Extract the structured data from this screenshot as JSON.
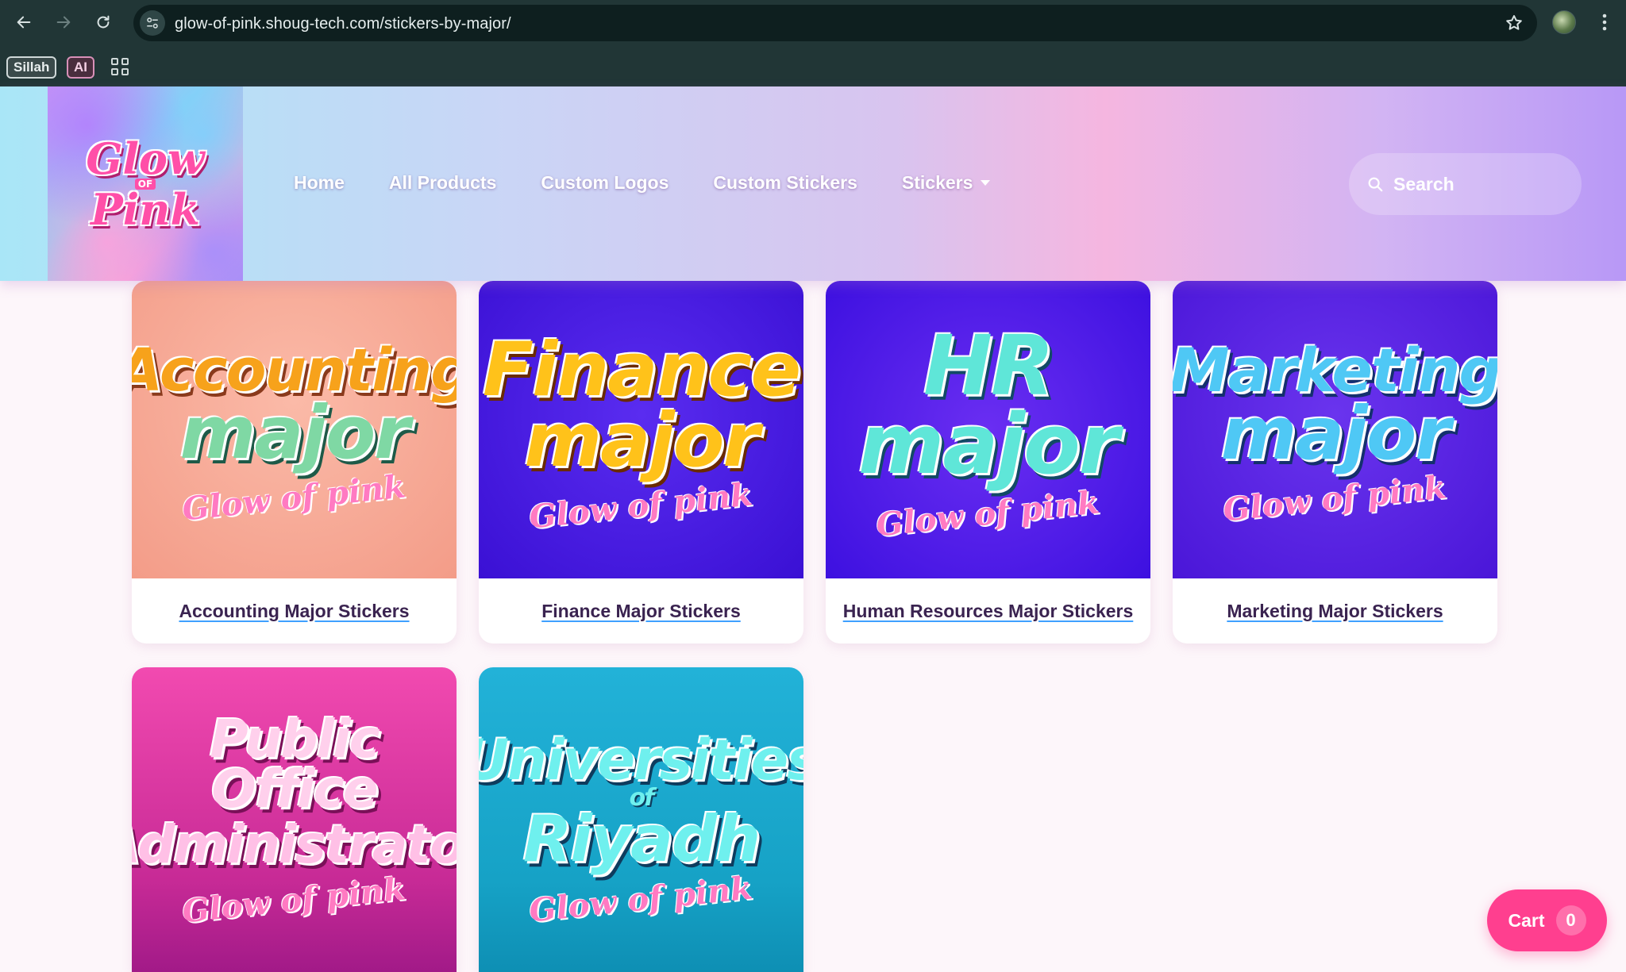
{
  "browser": {
    "url": "glow-of-pink.shoug-tech.com/stickers-by-major/",
    "bookmarks": [
      "Sillah",
      "AI"
    ]
  },
  "header": {
    "logo": {
      "line1": "Glow",
      "of": "OF",
      "line2": "Pink"
    },
    "nav": [
      {
        "label": "Home"
      },
      {
        "label": "All Products"
      },
      {
        "label": "Custom Logos"
      },
      {
        "label": "Custom Stickers"
      },
      {
        "label": "Stickers"
      }
    ],
    "search_placeholder": "Search"
  },
  "products": [
    {
      "title": "Accounting Major Stickers",
      "art_line1": "Accounting",
      "art_line2": "major",
      "art_sub": "Glow of pink",
      "colors": {
        "bg": "#f6a794",
        "line1": "#f7a21b",
        "line2": "#7fd8a4",
        "sub": "#f07cc0"
      }
    },
    {
      "title": "Finance Major Stickers",
      "art_line1": "Finance",
      "art_line2": "major",
      "art_sub": "Glow of pink",
      "colors": {
        "bg": "#4a1ae6",
        "line1": "#ffc21a",
        "line2": "#ffc21a",
        "sub": "#ff83c8"
      }
    },
    {
      "title": "Human Resources Major Stickers",
      "art_line1": "HR",
      "art_line2": "major",
      "art_sub": "Glow of pink",
      "colors": {
        "bg": "#4c1bea",
        "line1": "#5fe6d8",
        "line2": "#5fe6d8",
        "sub": "#ff83c8"
      }
    },
    {
      "title": "Marketing Major Stickers",
      "art_line1": "Marketing",
      "art_line2": "major",
      "art_sub": "Glow of pink",
      "colors": {
        "bg": "#5a22e0",
        "line1": "#4fc8f5",
        "line2": "#4fc8f5",
        "sub": "#ff83c8"
      }
    },
    {
      "title": "",
      "art_line1": "Public Office",
      "art_line2": "Administrator",
      "art_sub": "Glow of pink",
      "colors": {
        "bg": "#e23aa0",
        "line1": "#ffd0ec",
        "line2": "#ffc0e6",
        "sub": "#ffb0de"
      }
    },
    {
      "title": "",
      "art_line1": "Universities",
      "art_of": "of",
      "art_line2": "Riyadh",
      "art_sub": "Glow of pink",
      "colors": {
        "bg": "#1aa6c8",
        "line1": "#6ff0ee",
        "line2": "#6ff0ee",
        "sub": "#ff9ad2"
      }
    }
  ],
  "cart": {
    "label": "Cart",
    "count": "0"
  }
}
